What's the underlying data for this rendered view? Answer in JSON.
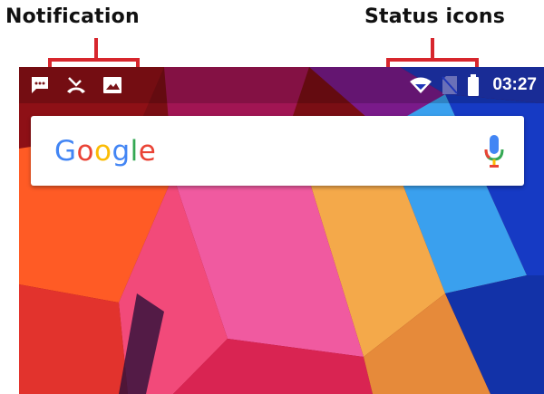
{
  "annotations": {
    "notification_label": "Notification",
    "status_label": "Status icons",
    "bracket_color": "#d7262d"
  },
  "status_bar": {
    "notification_icons": [
      "message-icon",
      "missed-call-icon",
      "image-icon"
    ],
    "status_icons": [
      "wifi-icon",
      "no-sim-icon",
      "battery-icon"
    ],
    "time": "03:27"
  },
  "search_widget": {
    "logo_letters": [
      "G",
      "o",
      "o",
      "g",
      "l",
      "e"
    ],
    "logo_colors": [
      "#4285F4",
      "#EA4335",
      "#FBBC05",
      "#4285F4",
      "#34A853",
      "#EA4335"
    ],
    "icon": "microphone-icon"
  }
}
